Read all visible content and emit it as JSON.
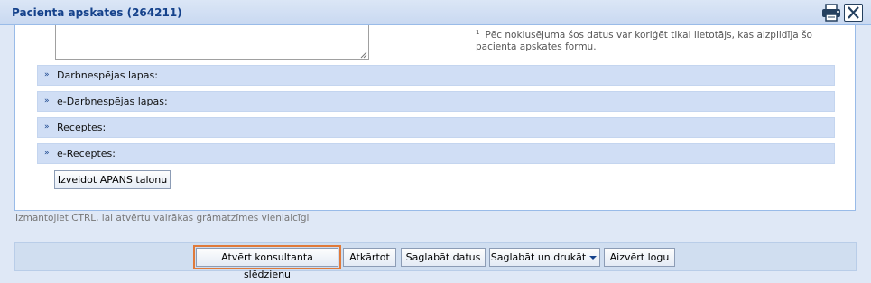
{
  "window": {
    "title": "Pacienta apskates (264211)",
    "print_icon": "printer-icon",
    "close_icon": "close-icon"
  },
  "footnote": {
    "marker": "1",
    "text": "Pēc noklusējuma šos datus var koriģēt tikai lietotājs, kas aizpildīja šo pacienta apskates formu."
  },
  "sections": [
    {
      "label": "Darbnespējas lapas:",
      "icon": "double-chevron-down-icon"
    },
    {
      "label": "e-Darbnespējas lapas:",
      "icon": "double-chevron-down-icon"
    },
    {
      "label": "Receptes:",
      "icon": "double-chevron-down-icon"
    },
    {
      "label": "e-Receptes:",
      "icon": "double-chevron-down-icon"
    }
  ],
  "apans_button": "Izveidot APANS talonu",
  "hint": "Izmantojiet CTRL, lai atvērtu vairākas grāmatzīmes vienlaicīgi",
  "footer_buttons": {
    "open_consultant": "Atvērt konsultanta slēdzienu",
    "cancel": "Atkārtot",
    "save": "Saglabāt datus",
    "save_print": "Saglabāt un drukāt",
    "close": "Aizvērt logu"
  }
}
